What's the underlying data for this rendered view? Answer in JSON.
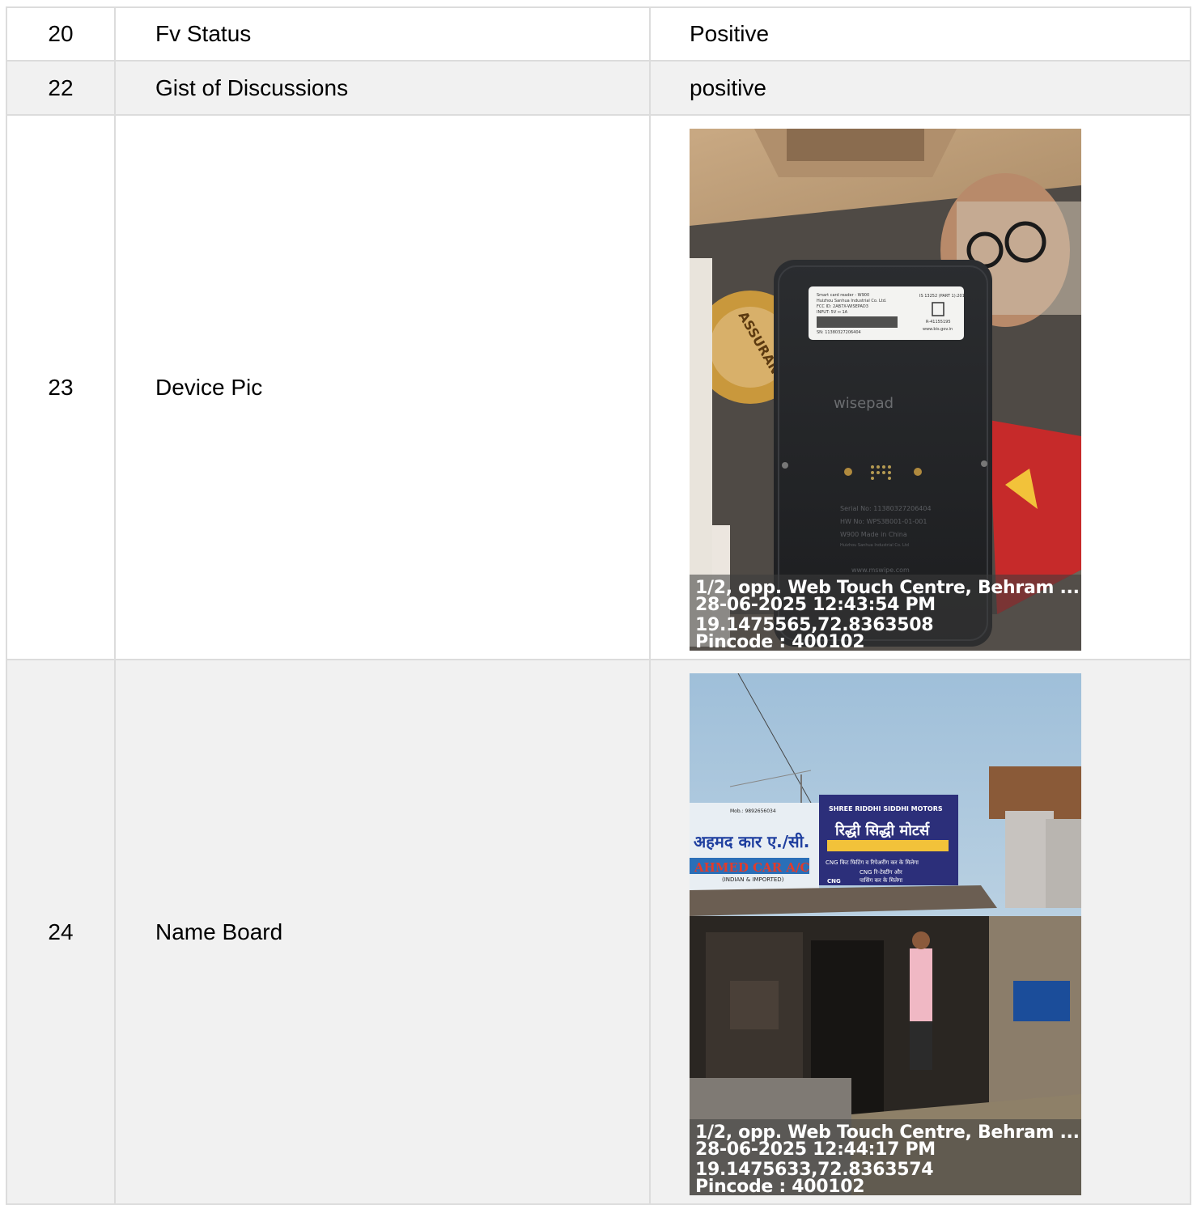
{
  "rows": [
    {
      "num": "20",
      "label": "Fv Status",
      "value": "Positive"
    },
    {
      "num": "22",
      "label": "Gist of Discussions",
      "value": "positive"
    },
    {
      "num": "23",
      "label": "Device Pic",
      "photo": {
        "subject": "card-reader-device-photo",
        "printed_text": {
          "device_brand": "wisepad",
          "label_line_1": "Smart card reader - W900",
          "label_line_2": "Huizhou Sanhua Industrial Co. Ltd.",
          "label_line_3": "FCC ID: 2AB7X-WISEPAD3",
          "label_line_4": "INPUT: 5V ⎓ 1A",
          "label_sn": "SN: 11380327206404",
          "label_is": "IS 13252 (PART 1):2010",
          "label_r": "R-41155195",
          "label_url": "www.bis.gov.in",
          "back_serial": "Serial No: 11380327206404",
          "back_hw": "HW No: WPS3B001-01-001",
          "back_made": "W900 Made in China",
          "back_maker": "Huizhou Sanhua Industrial Co. Ltd",
          "back_web": "www.mswipe.com",
          "badge_text": "ASSURANCE"
        },
        "stamp": {
          "address": "1/2, opp. Web Touch Centre, Behram ...",
          "datetime": "28-06-2025 12:43:54 PM",
          "coords": "19.1475565,72.8363508",
          "pincode": "Pincode : 400102"
        }
      }
    },
    {
      "num": "24",
      "label": "Name Board",
      "photo": {
        "subject": "shop-name-board-photo",
        "printed_text": {
          "board1_phone": "Mob.: 9892656034",
          "board1_hindi": "अहमद कार ए./सी.",
          "board1_english": "AHMED CAR A/C",
          "board1_sub": "(INDIAN & IMPORTED)",
          "board2_top": "SHREE RIDDHI SIDDHI MOTORS",
          "board2_hindi": "रिद्धी सिद्धी मोटर्स",
          "board2_line1": "CNG किट फिटिंग व रिपेअरींग कर के मिलेगा",
          "board2_line2": "CNG रि-टेस्टींग और",
          "board2_line3": "पासिंग कर के मिलेगा",
          "board2_cng": "CNG"
        },
        "stamp": {
          "address": "1/2, opp. Web Touch Centre, Behram ...",
          "datetime": "28-06-2025 12:44:17 PM",
          "coords": "19.1475633,72.8363574",
          "pincode": "Pincode : 400102"
        }
      }
    }
  ],
  "colors": {
    "border": "#dcdcdc",
    "row_grey": "#f1f1f1",
    "row_white": "#ffffff"
  }
}
